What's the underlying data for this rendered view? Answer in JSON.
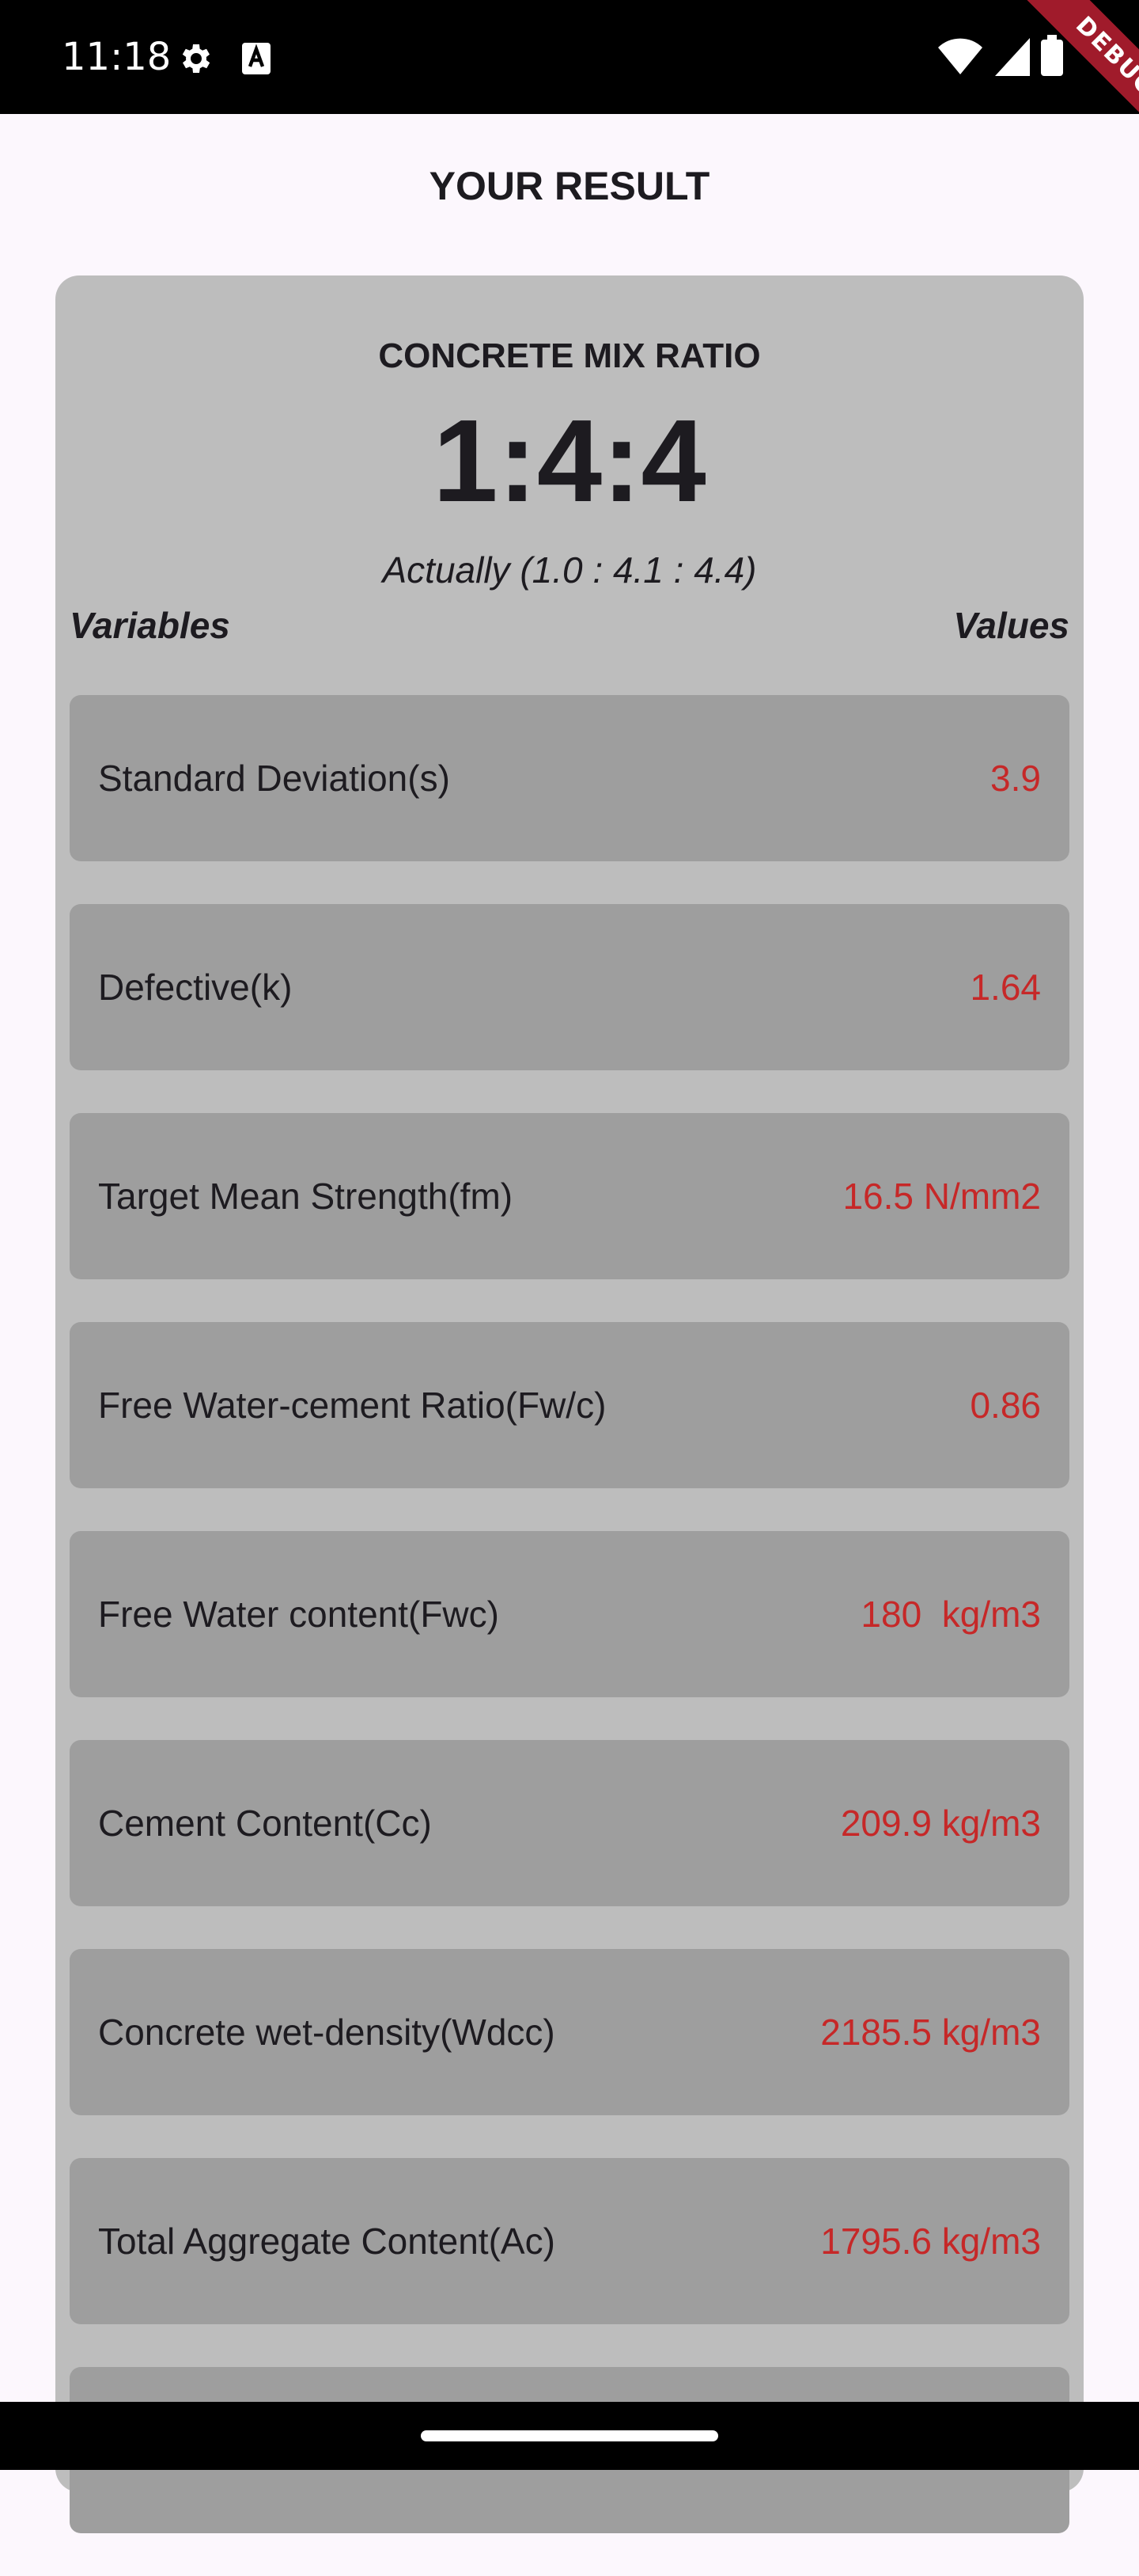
{
  "status_bar": {
    "time": "11:18",
    "icons": [
      "gear-icon",
      "a-icon",
      "wifi-icon",
      "signal-icon",
      "battery-icon"
    ]
  },
  "debug_banner": "DEBUG",
  "header": {
    "title": "YOUR RESULT"
  },
  "result_card": {
    "heading": "CONCRETE MIX RATIO",
    "ratio": "1:4:4",
    "actual": "Actually (1.0 : 4.1 : 4.4)",
    "variables_label": "Variables",
    "values_label": "Values",
    "rows": [
      {
        "label": "Standard Deviation(s)",
        "value": "3.9"
      },
      {
        "label": "Defective(k)",
        "value": "1.64"
      },
      {
        "label": "Target Mean Strength(fm)",
        "value": "16.5 N/mm2"
      },
      {
        "label": "Free Water-cement Ratio(Fw/c)",
        "value": "0.86"
      },
      {
        "label": "Free Water content(Fwc)",
        "value": "180  kg/m3"
      },
      {
        "label": "Cement Content(Cc)",
        "value": "209.9 kg/m3"
      },
      {
        "label": "Concrete wet-density(Wdcc)",
        "value": "2185.5 kg/m3"
      },
      {
        "label": "Total Aggregate Content(Ac)",
        "value": "1795.6 kg/m3"
      },
      {
        "label": "",
        "value": ""
      }
    ]
  },
  "colors": {
    "value_text": "#c62828",
    "card_bg": "#bdbdbd",
    "row_bg": "#9e9e9e",
    "debug_banner": "#a01b2b"
  }
}
